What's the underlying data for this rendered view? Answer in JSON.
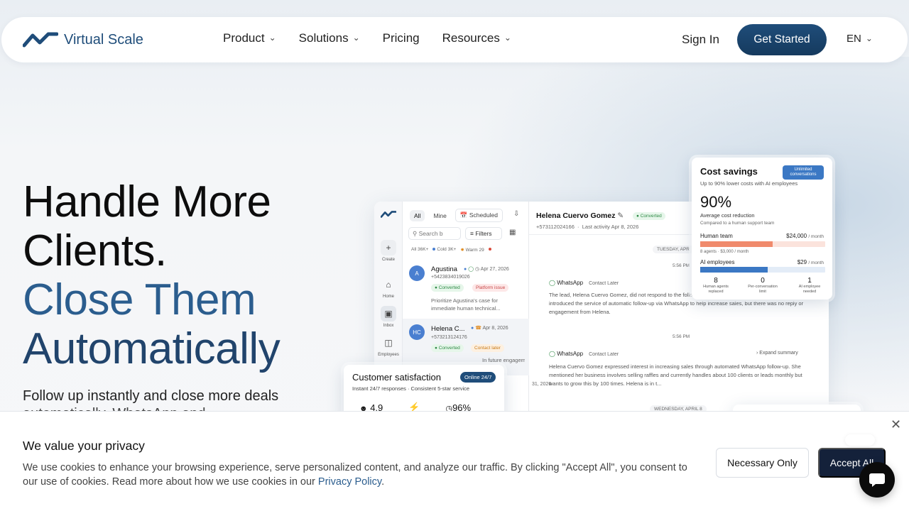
{
  "nav": {
    "brand": "Virtual Scale",
    "menu": [
      {
        "label": "Product",
        "has_dropdown": true
      },
      {
        "label": "Solutions",
        "has_dropdown": true
      },
      {
        "label": "Pricing",
        "has_dropdown": false
      },
      {
        "label": "Resources",
        "has_dropdown": true
      }
    ],
    "sign_in": "Sign In",
    "get_started": "Get Started",
    "language": "EN"
  },
  "hero": {
    "line1": "Handle More",
    "line2": "Clients.",
    "line3": "Close Them",
    "line4": "Automatically",
    "subtitle": "Follow up instantly and close more deals",
    "subtitle2": "automatically. WhatsApp and phone"
  },
  "app": {
    "rail": {
      "create": "Create",
      "home": "Home",
      "inbox": "Inbox",
      "employees": "Employees"
    },
    "tabs": [
      "All",
      "Mine",
      "Scheduled"
    ],
    "search_placeholder": "Search b",
    "filters": "Filters",
    "counts": {
      "all": "All",
      "all_n": "36K+",
      "cold": "Cold",
      "cold_n": "3K+",
      "warm": "Warm",
      "warm_n": "29"
    },
    "leads": [
      {
        "initial": "A",
        "name": "Agustina",
        "phone": "+5423834019026",
        "date": "Apr 27, 2026",
        "badge1": "Converted",
        "badge2": "Platform issue",
        "note": "Prioritize Agustina's case for immediate human technical..."
      },
      {
        "initial": "HC",
        "name": "Helena C...",
        "phone": "+573213124176",
        "date": "Apr 8, 2026",
        "badge1": "Converted",
        "badge2": "Contact later",
        "note": "In future engagements, the agent"
      }
    ],
    "partial_date": "31, 2026",
    "chat": {
      "name": "Helena Cuervo Gomez",
      "status": "Converted",
      "phone": "+573112024166",
      "last_activity": "Last activity Apr 8, 2026",
      "day1": "TUESDAY, APR",
      "time1": "5:56 PM",
      "msg1_channel": "WhatsApp",
      "msg1_tag": "Contact Later",
      "msg1_text": "The lead, Helena Cuervo Gomez, did not respond to the follow-up message from Virtual Scale. The message introduced the service of automatic follow-up via WhatsApp to help increase sales, but there was no reply or engagement from Helena.",
      "time2": "5:56 PM",
      "msg2_channel": "WhatsApp",
      "msg2_tag": "Contact Later",
      "expand": "Expand summary",
      "msg2_text": "Helena Cuervo Gomez expressed interest in increasing sales through automated WhatsApp follow-up. She mentioned her business involves selling raffles and currently handles about 100 clients or leads monthly but wants to grow this by 100 times. Helena is in t...",
      "day2": "WEDNESDAY, APRIL 8"
    }
  },
  "cost_card": {
    "title": "Cost savings",
    "badge": "Unlimited conversations",
    "subtitle": "Up to 90% lower costs with AI employees",
    "big": "90%",
    "avg": "Average cost reduction",
    "compare": "Compared to a human support team",
    "human_label": "Human team",
    "human_cost": "$24,000",
    "human_unit": "/ month",
    "human_sub": "8 agents · $3,000 / month",
    "human_fraction": 0.58,
    "ai_label": "AI employees",
    "ai_cost": "$29",
    "ai_unit": "/ month",
    "ai_fraction": 0.54,
    "stats": [
      {
        "value": "8",
        "label": "Human agents replaced"
      },
      {
        "value": "0",
        "label": "Per-conversation limit"
      },
      {
        "value": "1",
        "label": "AI employee needed"
      }
    ],
    "colors": {
      "human": "#f08a6c",
      "human_bg": "#fbe3dc",
      "ai": "#3b78c4",
      "ai_bg": "#e3ecf7"
    }
  },
  "csat_card": {
    "title": "Customer satisfaction",
    "badge": "Online 24/7",
    "subtitle": "Instant 24/7 responses · Consistent 5-star service",
    "rating": "4.9",
    "percent": "96%"
  },
  "cookie": {
    "title": "We value your privacy",
    "text": "We use cookies to enhance your browsing experience, serve personalized content, and analyze our traffic. By clicking \"Accept All\", you consent to our use of cookies. Read more about how we use cookies in our ",
    "link": "Privacy Policy",
    "period": ".",
    "necessary": "Necessary Only",
    "accept": "Accept All"
  }
}
